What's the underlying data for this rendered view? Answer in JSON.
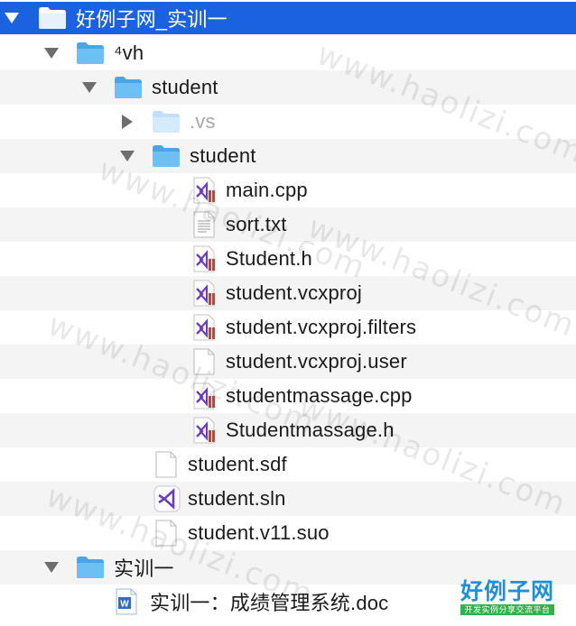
{
  "tree": {
    "rows": [
      {
        "label": "好例子网_实训一"
      },
      {
        "label": "⁴vh"
      },
      {
        "label": "student"
      },
      {
        "label": ".vs"
      },
      {
        "label": "student"
      },
      {
        "label": "main.cpp"
      },
      {
        "label": "sort.txt"
      },
      {
        "label": "Student.h"
      },
      {
        "label": "student.vcxproj"
      },
      {
        "label": "student.vcxproj.filters"
      },
      {
        "label": "student.vcxproj.user"
      },
      {
        "label": "studentmassage.cpp"
      },
      {
        "label": "Studentmassage.h"
      },
      {
        "label": "student.sdf"
      },
      {
        "label": "student.sln"
      },
      {
        "label": "student.v11.suo"
      },
      {
        "label": "实训一"
      },
      {
        "label": "实训一：成绩管理系统.doc"
      }
    ]
  },
  "watermark": {
    "text": "www.haolizi.com"
  },
  "logo": {
    "main": "好例子网",
    "sub": "开发实例分享交流平台"
  },
  "colors": {
    "selection": "#1b62e0",
    "folder": "#5bb1ec",
    "vs_purple": "#6b3fb8",
    "vs_red": "#d63b2f",
    "stripe": "#f4f4f4"
  }
}
